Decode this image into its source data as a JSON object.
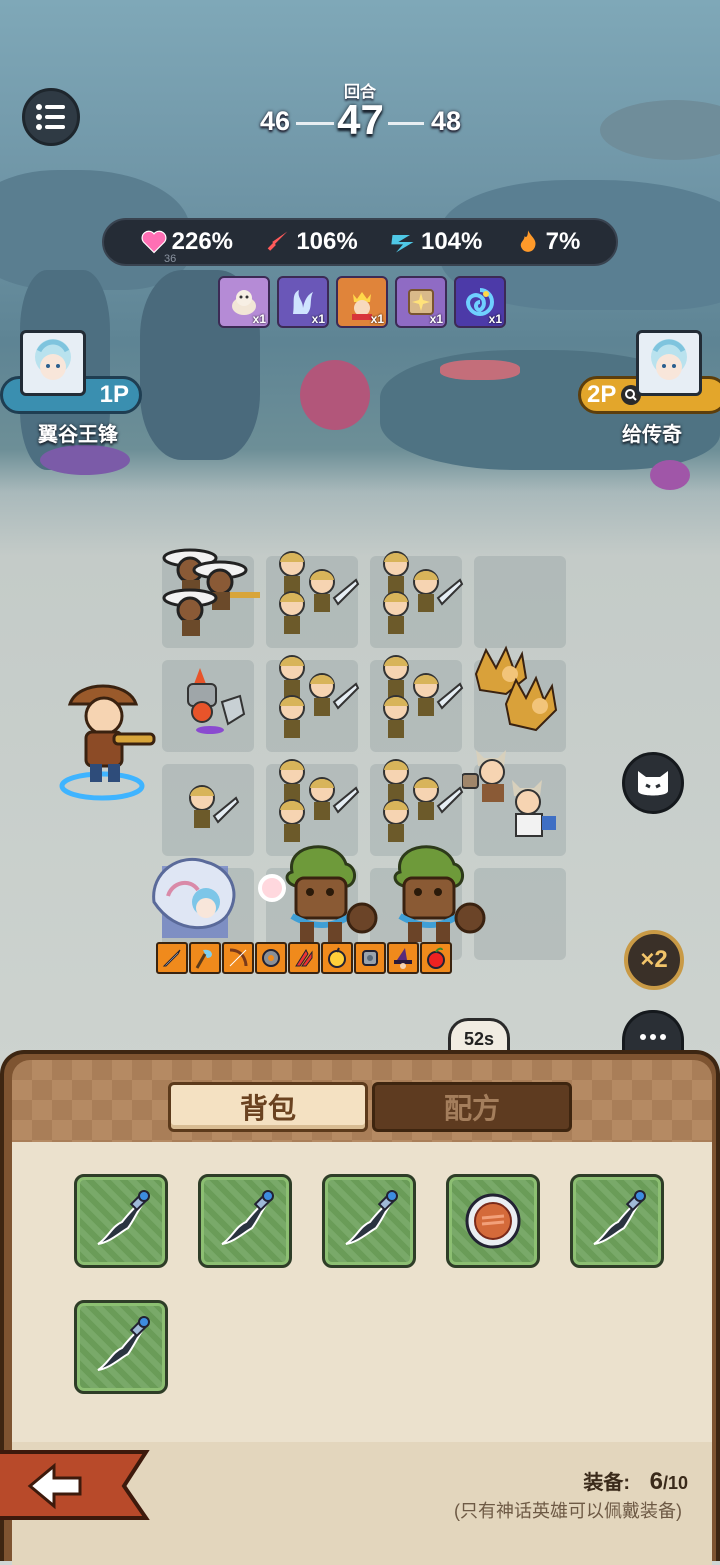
{
  "hud": {
    "round_label": "回合",
    "round_prev": "46",
    "round_current": "47",
    "round_next": "48"
  },
  "stats": [
    {
      "name": "health",
      "icon": "heart-icon",
      "value": "226%",
      "color": "#ff6fb4"
    },
    {
      "name": "attack",
      "icon": "sword-icon",
      "value": "106%",
      "color": "#ff5a5a"
    },
    {
      "name": "speed",
      "icon": "speed-icon",
      "value": "104%",
      "color": "#4fc8e6"
    },
    {
      "name": "crit",
      "icon": "flame-icon",
      "value": "7%",
      "color": "#ff9a2a"
    }
  ],
  "stats_small_number": "36",
  "relics": [
    {
      "name": "hamster-relic",
      "count": "x1",
      "bg": "#b58bd6"
    },
    {
      "name": "spirit-relic",
      "count": "x1",
      "bg": "#6a57b8"
    },
    {
      "name": "king-relic",
      "count": "x1",
      "bg": "#e0843a"
    },
    {
      "name": "star-box-relic",
      "count": "x1",
      "bg": "#8f6bc4"
    },
    {
      "name": "vortex-relic",
      "count": "x1",
      "bg": "#4c3aa8"
    }
  ],
  "player1": {
    "tag": "1P",
    "name": "翼谷王锋"
  },
  "player2": {
    "tag": "2P",
    "name": "给传奇"
  },
  "side": {
    "speed_label": "×2",
    "timer": "52s"
  },
  "equipment_strip": [
    "dagger",
    "axe",
    "bow",
    "gear",
    "claw",
    "bomb",
    "cog",
    "witch",
    "apple"
  ],
  "panel": {
    "tab_backpack": "背包",
    "tab_recipe": "配方",
    "items": [
      "dagger",
      "dagger",
      "dagger",
      "shield",
      "dagger",
      "dagger"
    ],
    "equip_label": "装备:",
    "equip_current": "6",
    "equip_max": "/10",
    "equip_note": "(只有神话英雄可以佩戴装备)"
  }
}
